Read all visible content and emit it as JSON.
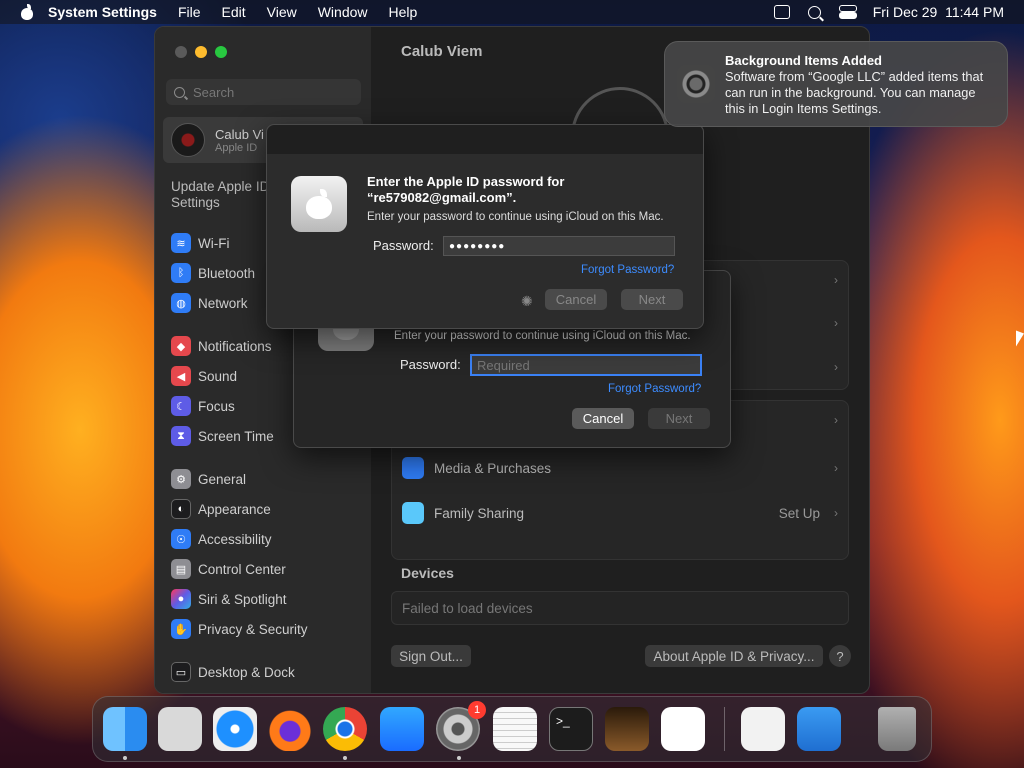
{
  "menubar": {
    "app": "System Settings",
    "items": [
      "File",
      "Edit",
      "View",
      "Window",
      "Help"
    ],
    "datetime": "Fri Dec 29  11:44 PM"
  },
  "sidebar": {
    "search_placeholder": "Search",
    "account_name": "Calub Vi",
    "account_sub": "Apple ID",
    "update_text": "Update Apple ID Settings",
    "items": [
      {
        "label": "Wi-Fi",
        "color": "#2f7cf6",
        "icon": "wifi-icon"
      },
      {
        "label": "Bluetooth",
        "color": "#2f7cf6",
        "icon": "bluetooth-icon"
      },
      {
        "label": "Network",
        "color": "#2f7cf6",
        "icon": "globe-icon"
      },
      {
        "label": "Notifications",
        "color": "#e5484d",
        "icon": "bell-icon"
      },
      {
        "label": "Sound",
        "color": "#e5484d",
        "icon": "speaker-icon"
      },
      {
        "label": "Focus",
        "color": "#5e5ce6",
        "icon": "moon-icon"
      },
      {
        "label": "Screen Time",
        "color": "#5e5ce6",
        "icon": "hourglass-icon"
      },
      {
        "label": "General",
        "color": "#8e8e93",
        "icon": "gear-icon"
      },
      {
        "label": "Appearance",
        "color": "#1c1c1e",
        "icon": "appearance-icon"
      },
      {
        "label": "Accessibility",
        "color": "#2f7cf6",
        "icon": "accessibility-icon"
      },
      {
        "label": "Control Center",
        "color": "#8e8e93",
        "icon": "control-center-icon"
      },
      {
        "label": "Siri & Spotlight",
        "color": "#bf5af2",
        "icon": "siri-icon"
      },
      {
        "label": "Privacy & Security",
        "color": "#2f7cf6",
        "icon": "hand-icon"
      },
      {
        "label": "Desktop & Dock",
        "color": "#1c1c1e",
        "icon": "dock-icon"
      }
    ]
  },
  "content": {
    "title": "Calub Viem",
    "rows": [
      {
        "label": "Media & Purchases",
        "value": ""
      },
      {
        "label": "Family Sharing",
        "value": "Set Up"
      }
    ],
    "devices_heading": "Devices",
    "devices_status": "Failed to load devices",
    "sign_out": "Sign Out...",
    "about": "About Apple ID & Privacy...",
    "help": "?"
  },
  "dialog_front": {
    "title": "Enter the Apple ID password for “re579082@gmail.com”.",
    "subtitle": "Enter your password to continue using iCloud on this Mac.",
    "password_label": "Password:",
    "password_value": "●●●●●●●●",
    "forgot": "Forgot Password?",
    "cancel": "Cancel",
    "next": "Next"
  },
  "dialog_back": {
    "subtitle": "Enter your password to continue using iCloud on this Mac.",
    "password_label": "Password:",
    "password_placeholder": "Required",
    "forgot": "Forgot Password?",
    "cancel": "Cancel",
    "next": "Next"
  },
  "notification": {
    "title": "Background Items Added",
    "body": "Software from “Google LLC” added items that can run in the background. You can manage this in Login Items Settings."
  },
  "dock": {
    "badge": "1",
    "apps": [
      {
        "name": "finder",
        "color": "#2a8cf0"
      },
      {
        "name": "launchpad",
        "color": "#d9d9d9"
      },
      {
        "name": "safari",
        "color": "#1e90ff"
      },
      {
        "name": "firefox",
        "color": "#ff7a18"
      },
      {
        "name": "chrome",
        "color": "#f2f2f2"
      },
      {
        "name": "app-store",
        "color": "#1a8cff"
      },
      {
        "name": "system-settings",
        "color": "#8e8e93"
      },
      {
        "name": "textedit",
        "color": "#f2f2f2"
      },
      {
        "name": "terminal",
        "color": "#1c1c1c"
      },
      {
        "name": "garageband",
        "color": "#6b4a2a"
      },
      {
        "name": "vscode",
        "color": "#ffffff"
      },
      {
        "name": "visual-studio",
        "color": "#f2f2f2"
      },
      {
        "name": "weather",
        "color": "#2f84e6"
      },
      {
        "name": "trash",
        "color": "#9a9a9a"
      }
    ]
  }
}
